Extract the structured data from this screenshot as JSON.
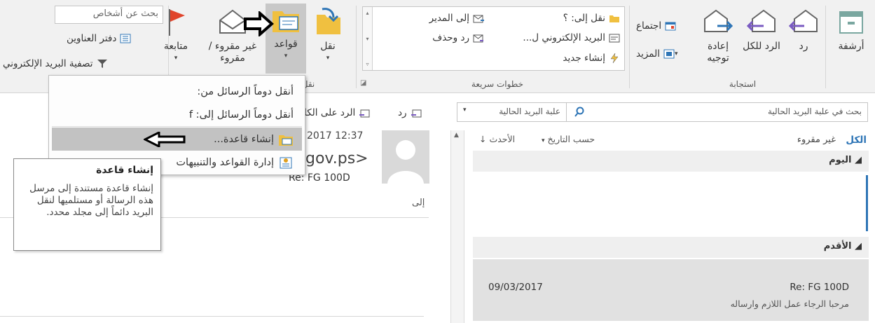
{
  "ribbon": {
    "groups": {
      "respond": "استجابة",
      "quick_steps": "خطوات سريعة",
      "move": "نقل"
    },
    "buttons": {
      "archive": "أرشفة",
      "reply": "رد",
      "reply_all": "الرد للكل",
      "forward": "إعادة توجيه",
      "meeting": "اجتماع",
      "more": "المزيد",
      "move": "نقل",
      "rules": "قواعد",
      "unread_read": "غير مقروء / مقروء",
      "follow_up": "متابعة"
    },
    "quick_steps": {
      "move_to": "نقل إلى: ؟",
      "to_manager": "إلى المدير",
      "team_email": "البريد الإلكتروني ل...",
      "reply_delete": "رد وحذف",
      "create_new": "إنشاء جديد"
    },
    "find": {
      "people_search_placeholder": "بحث عن أشخاص",
      "address_book": "دفتر العناوين",
      "filter_email": "تصفية البريد الإلكتروني"
    }
  },
  "rules_menu": {
    "items": [
      "أنقل دوماً الرسائل من:",
      "أنقل دوماً الرسائل إلى: f",
      "إنشاء قاعدة...",
      "إدارة القواعد والتنبيهات"
    ]
  },
  "tooltip": {
    "title": "إنشاء قاعدة",
    "body": "إنشاء قاعدة مستندة إلى مرسل هذه الرسالة أو مستلميها لنقل البريد دائماً إلى مجلد محدد."
  },
  "reading_pane": {
    "reply": "رد",
    "reply_all_partial": "الرد على الكل",
    "date": "2017 12:37",
    "sender_partial": "gov.ps>",
    "subject": "Re: FG 100D",
    "to_label": "إلى"
  },
  "message_list": {
    "search_placeholder": "بحث في علبة البريد الحالية",
    "scope": "علبة البريد الحالية",
    "filter_all": "الكل",
    "filter_unread": "غير مقروء",
    "sort_by": "حسب التاريخ",
    "order": "الأحدث",
    "group_today": "اليوم",
    "group_older": "الأقدم",
    "message": {
      "subject": "Re: FG 100D",
      "date": "09/03/2017",
      "preview": "مرحبا الرجاء عمل اللازم وارساله"
    }
  },
  "colors": {
    "ribbon_bg": "#f1f1f1",
    "accent_blue": "#2e75b6",
    "flag_red": "#e0442b",
    "folder_yellow": "#f0c040",
    "highlight_grey": "#c2c2c2"
  }
}
